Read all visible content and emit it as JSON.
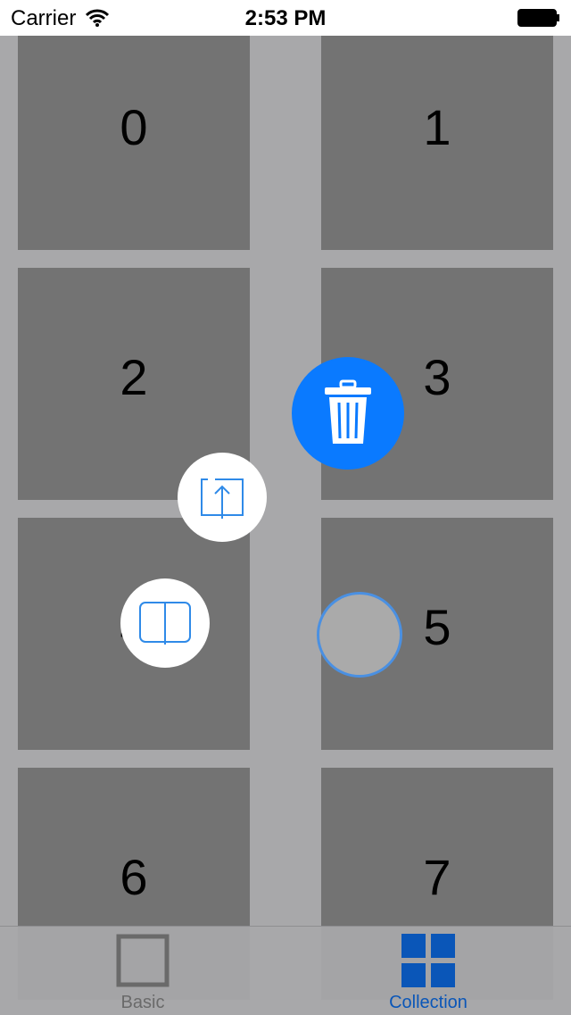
{
  "status_bar": {
    "carrier": "Carrier",
    "time": "2:53 PM",
    "wifi_icon": "wifi-icon",
    "battery_icon": "battery-icon"
  },
  "grid": {
    "cells": [
      "0",
      "1",
      "2",
      "3",
      "4",
      "5",
      "6",
      "7"
    ]
  },
  "menu": {
    "actions": [
      {
        "name": "share",
        "icon": "share-icon"
      },
      {
        "name": "read",
        "icon": "book-icon"
      },
      {
        "name": "delete",
        "icon": "trash-icon"
      }
    ],
    "center_button": "menu-toggle"
  },
  "tab_bar": {
    "items": [
      {
        "label": "Basic",
        "icon": "square-outline-icon",
        "selected": false
      },
      {
        "label": "Collection",
        "icon": "grid-icon",
        "selected": true
      }
    ]
  },
  "colors": {
    "accent": "#0a7aff",
    "background": "#a8a8aa",
    "cell": "#737373",
    "tab_selected": "#0a56b8"
  }
}
